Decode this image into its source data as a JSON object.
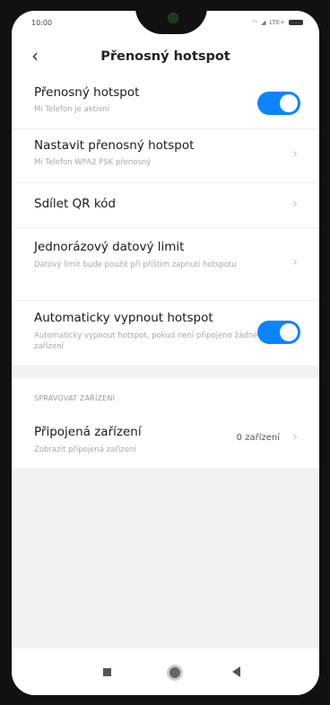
{
  "status": {
    "time": "10:00",
    "network": "LTE+"
  },
  "header": {
    "back_glyph": "‹",
    "title": "Přenosný hotspot"
  },
  "settings": [
    {
      "title": "Přenosný hotspot",
      "subtitle": "Mi Telefon je aktivní",
      "control": "toggle",
      "on": true
    },
    {
      "title": "Nastavit přenosný hotspot",
      "subtitle": "Mi Telefon WPA2 PSK přenosný",
      "control": "chevron"
    },
    {
      "title": "Sdílet QR kód",
      "subtitle": "",
      "control": "chevron"
    },
    {
      "title": "Jednorázový datový limit",
      "subtitle": "Datový limit bude použit při příštím zapnutí hotspotu",
      "control": "chevron"
    },
    {
      "title": "Automaticky vypnout hotspot",
      "subtitle": "Automaticky vypnout hotspot, pokud není připojeno žádné zařízení",
      "control": "toggle",
      "on": true
    }
  ],
  "devices_section": {
    "header": "SPRAVOVAT ZAŘÍZENÍ",
    "item": {
      "title": "Připojená zařízení",
      "subtitle": "Zobrazit připojená zařízení",
      "value": "0 zařízení"
    }
  },
  "chevron_glyph": "›",
  "colors": {
    "accent": "#0d84ff",
    "background": "#f2f2f2"
  }
}
